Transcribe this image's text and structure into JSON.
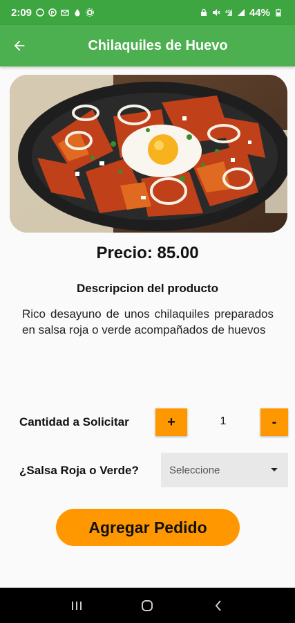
{
  "status_bar": {
    "time": "2:09",
    "battery": "44%",
    "left_icons": [
      "whatsapp-icon",
      "pinterest-icon",
      "mail-icon",
      "water-drop-icon",
      "settings-icon"
    ],
    "right_icons": [
      "lock-icon",
      "mute-icon",
      "4g-signal-icon",
      "signal-icon",
      "battery-icon"
    ]
  },
  "app_bar": {
    "title": "Chilaquiles de Huevo",
    "back_icon": "arrow-left-icon"
  },
  "product": {
    "price_text": "Precio: 85.00",
    "description_title": "Descripcion del producto",
    "description": "Rico desayuno de unos chilaquiles preparados en salsa roja o verde acompañados de huevos"
  },
  "quantity": {
    "label": "Cantidad a Solicitar",
    "increment_label": "+",
    "decrement_label": "-",
    "value": "1"
  },
  "salsa": {
    "label": "¿Salsa Roja o Verde?",
    "selected": "Seleccione"
  },
  "add_button": {
    "label": "Agregar Pedido"
  },
  "colors": {
    "status_bar": "#3da640",
    "app_bar": "#4caf50",
    "accent": "#ff9800",
    "nav_bar": "#000000"
  },
  "nav_bar": {
    "icons": [
      "recent-apps-icon",
      "home-icon",
      "back-icon"
    ]
  }
}
